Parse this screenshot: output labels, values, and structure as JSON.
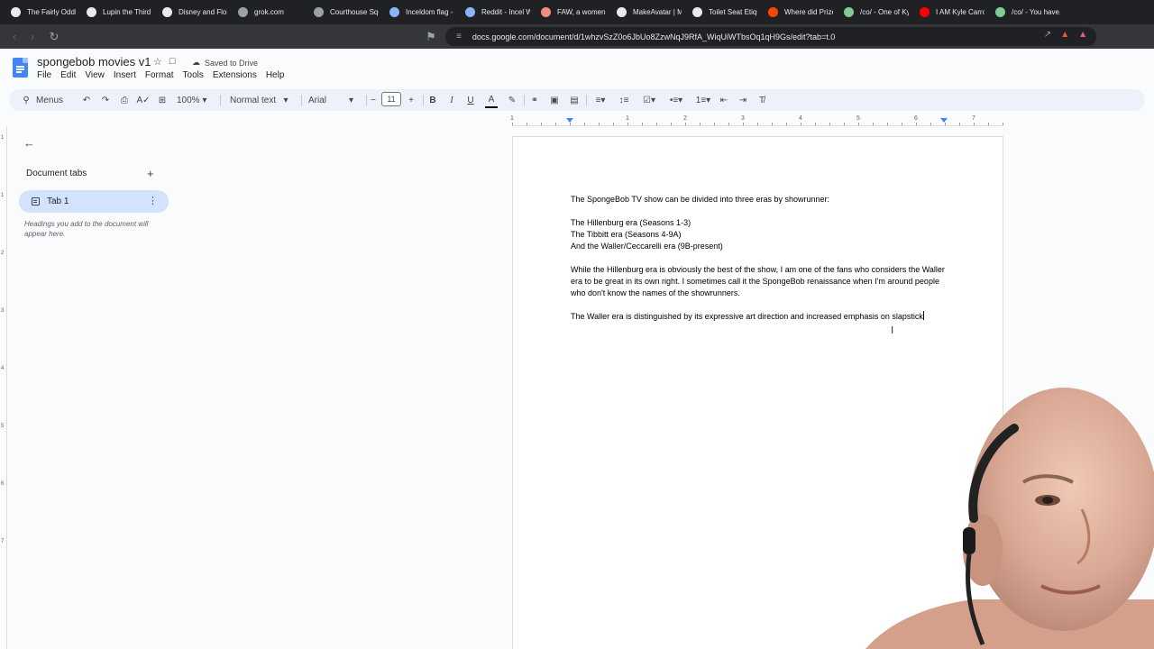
{
  "browser": {
    "tabs": [
      {
        "title": "The Fairly OddP...",
        "icon": "wordpress-icon",
        "color": "#e8eaed"
      },
      {
        "title": "Lupin the Third",
        "icon": "wordpress-icon",
        "color": "#e8eaed"
      },
      {
        "title": "Disney and Flori...",
        "icon": "wordpress-icon",
        "color": "#e8eaed"
      },
      {
        "title": "grok.com",
        "icon": "grok-icon",
        "color": "#9aa0a6"
      },
      {
        "title": "Courthouse Squ...",
        "icon": "wordpress-icon",
        "color": "#9aa0a6"
      },
      {
        "title": "Inceldom flag - ...",
        "icon": "site-icon",
        "color": "#8ab4f8"
      },
      {
        "title": "Reddit - Incel W...",
        "icon": "site-icon",
        "color": "#8ab4f8"
      },
      {
        "title": "FAW, a women-...",
        "icon": "site-icon",
        "color": "#f28b82"
      },
      {
        "title": "MakeAvatar | M...",
        "icon": "x-icon",
        "color": "#e8eaed"
      },
      {
        "title": "Toilet Seat Etiqu...",
        "icon": "site-icon",
        "color": "#e8eaed"
      },
      {
        "title": "Where did Prize...",
        "icon": "reddit-icon",
        "color": "#ff4500"
      },
      {
        "title": "/co/ - One of Ky...",
        "icon": "site-icon",
        "color": "#81c995"
      },
      {
        "title": "I AM Kyle Carro...",
        "icon": "youtube-icon",
        "color": "#ff0000"
      },
      {
        "title": "/co/ - You have...",
        "icon": "site-icon",
        "color": "#81c995"
      }
    ],
    "url": "docs.google.com/document/d/1whzvSzZ0o6JbUo8ZzwNqJ9RfA_WiqUiWTbsOq1qH9Gs/edit?tab=t.0"
  },
  "doc": {
    "title": "spongebob movies v1",
    "saved_status": "Saved to Drive",
    "menu": [
      "File",
      "Edit",
      "View",
      "Insert",
      "Format",
      "Tools",
      "Extensions",
      "Help"
    ]
  },
  "toolbar": {
    "search_label": "Menus",
    "zoom": "100%",
    "style": "Normal text",
    "font": "Arial",
    "font_size": "11"
  },
  "ruler": [
    "1",
    "1",
    "2",
    "3",
    "4",
    "5",
    "6",
    "7"
  ],
  "vruler": [
    "1",
    "1",
    "2",
    "3",
    "4",
    "5",
    "6",
    "7"
  ],
  "sidebar": {
    "heading": "Document tabs",
    "tab_label": "Tab 1",
    "hint": "Headings you add to the document will appear here."
  },
  "body": {
    "p1": "The SpongeBob TV show can be divided into three eras by showrunner:",
    "p2": "The Hillenburg era (Seasons 1-3)",
    "p3": "The Tibbitt era (Seasons 4-9A)",
    "p4": "And the Waller/Ceccarelli era (9B-present)",
    "p5": "While the Hillenburg era is obviously the best of the show, I am one of the fans who considers the Waller era to be great in its own right. I sometimes call it the SpongeBob renaissance when I'm around people who don't know the names of the showrunners.",
    "p6": "The Waller era is distinguished by its expressive art direction and increased emphasis on slapstick"
  }
}
